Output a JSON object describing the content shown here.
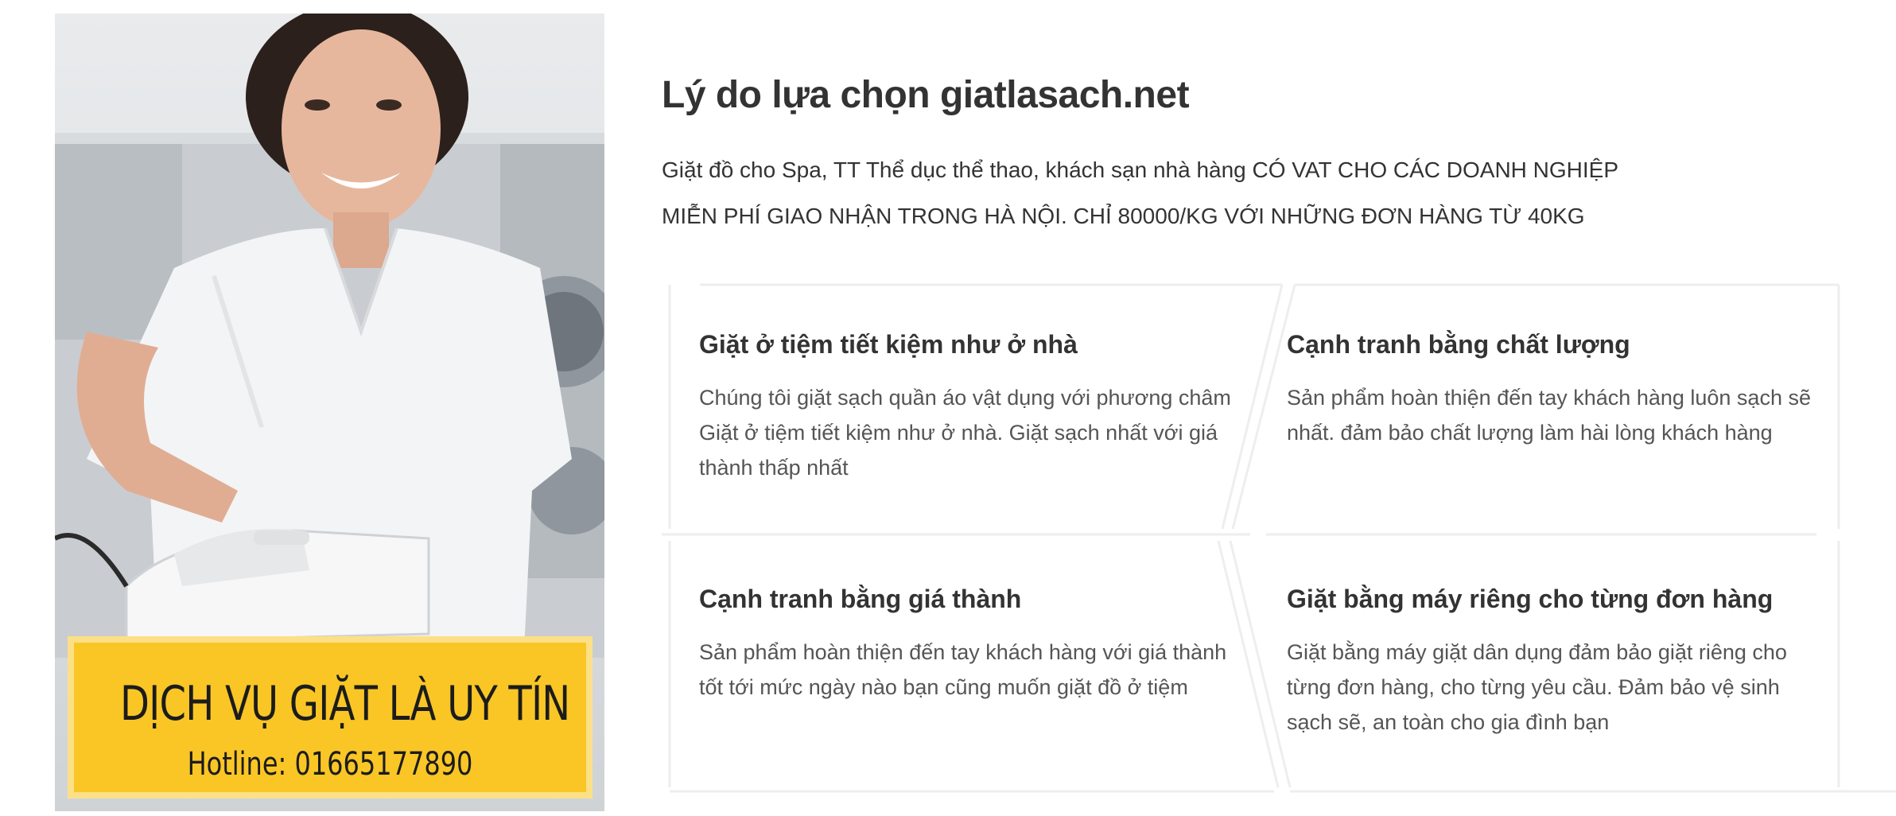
{
  "promo": {
    "banner_title": "DỊCH VỤ GIẶT LÀ UY TÍN",
    "hotline": "Hotline: 01665177890",
    "brand_color": "#f9c626"
  },
  "section": {
    "title": "Lý do lựa chọn giatlasach.net",
    "intro_line_1": "Giặt đồ cho Spa, TT Thể dục thể thao, khách sạn nhà hàng CÓ VAT CHO CÁC DOANH NGHIỆP",
    "intro_line_2": "MIỄN PHÍ GIAO NHẬN TRONG HÀ NỘI. CHỈ 80000/KG VỚI NHỮNG ĐƠN HÀNG TỪ 40KG"
  },
  "features": [
    {
      "title": "Giặt ở tiệm tiết kiệm như ở nhà",
      "description": "Chúng tôi giặt sạch quần áo vật dụng với phương châm Giặt ở tiệm tiết kiệm như ở nhà. Giặt sạch nhất với giá thành thấp nhất"
    },
    {
      "title": "Cạnh tranh bằng chất lượng",
      "description": "Sản phẩm hoàn thiện đến tay khách hàng luôn sạch sẽ nhất. đảm bảo chất lượng làm hài lòng khách hàng"
    },
    {
      "title": "Cạnh tranh bằng giá thành",
      "description": "Sản phẩm hoàn thiện đến tay khách hàng với giá thành tốt tới mức ngày nào bạn cũng muốn giặt đồ ở tiệm"
    },
    {
      "title": "Giặt bằng máy riêng cho từng đơn hàng",
      "description": "Giặt bằng máy giặt dân dụng đảm bảo giặt riêng cho từng đơn hàng, cho từng yêu cầu. Đảm bảo vệ sinh sạch sẽ, an toàn cho gia đình bạn"
    }
  ]
}
